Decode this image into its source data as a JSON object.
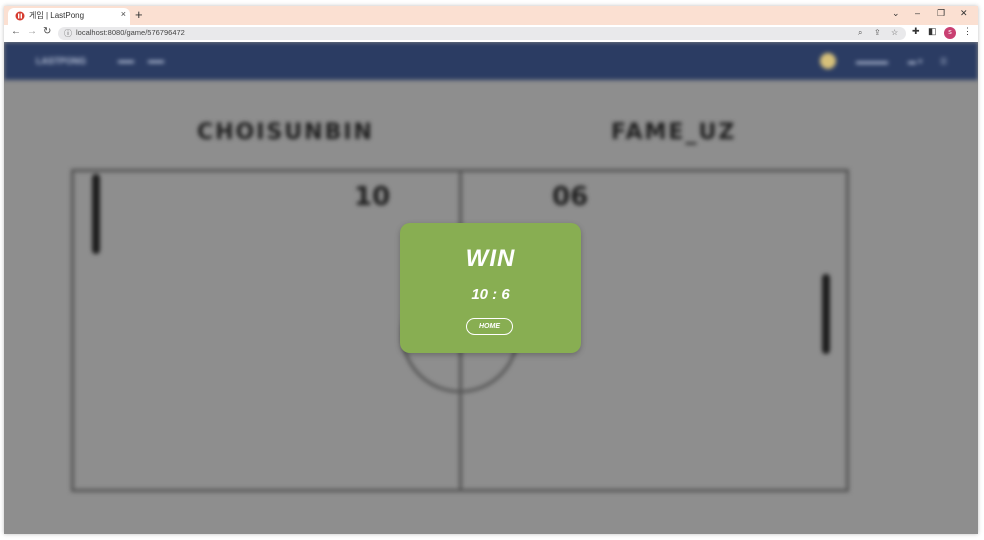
{
  "browser": {
    "tab_title": "게임 | LastPong",
    "tab_close": "×",
    "new_tab": "+",
    "url": "localhost:8080/game/576796472",
    "profile_initial": "s",
    "window_controls": {
      "chevron": "⌄",
      "minimize": "–",
      "restore": "❐",
      "close": "✕"
    }
  },
  "game": {
    "left_player": "CHOISUNBIN",
    "right_player": "FAME_UZ",
    "left_score": "10",
    "right_score": "06"
  },
  "modal": {
    "result": "WIN",
    "score_text": "10 : 6",
    "home_label": "HOME"
  },
  "colors": {
    "modal_bg": "#88ae52",
    "app_nav": "#2b3c63",
    "tab_strip": "#fbe0d2"
  },
  "icons": {
    "back": "arrow-left-icon",
    "forward": "arrow-right-icon",
    "reload": "reload-icon",
    "zoom": "zoom-icon",
    "share": "share-icon",
    "bookmark": "star-icon",
    "extensions": "puzzle-icon",
    "sidepanel": "sidepanel-icon",
    "menu": "kebab-menu-icon"
  }
}
